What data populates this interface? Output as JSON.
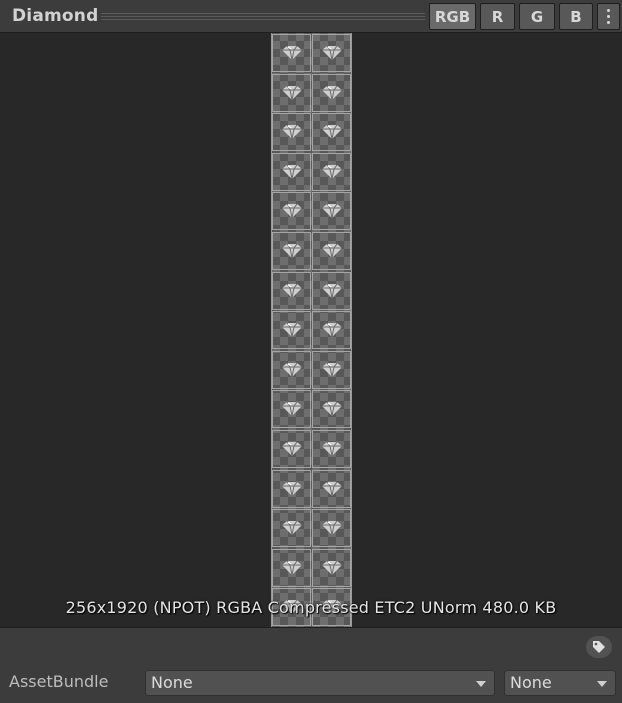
{
  "header": {
    "title": "Diamond",
    "channels": [
      "RGB",
      "R",
      "G",
      "B"
    ],
    "active_channel": "RGB",
    "menu_icon": "kebab-menu-icon"
  },
  "preview": {
    "info_text": "256x1920 (NPOT)  RGBA Compressed ETC2 UNorm   480.0 KB"
  },
  "bottom": {
    "tag_icon": "tag-icon",
    "assetbundle_label": "AssetBundle",
    "bundle_name": "None",
    "bundle_variant": "None"
  },
  "colors": {
    "background": "#282828",
    "panel": "#3c3c3c",
    "button": "#585858",
    "active_button": "#6a6a6a"
  }
}
